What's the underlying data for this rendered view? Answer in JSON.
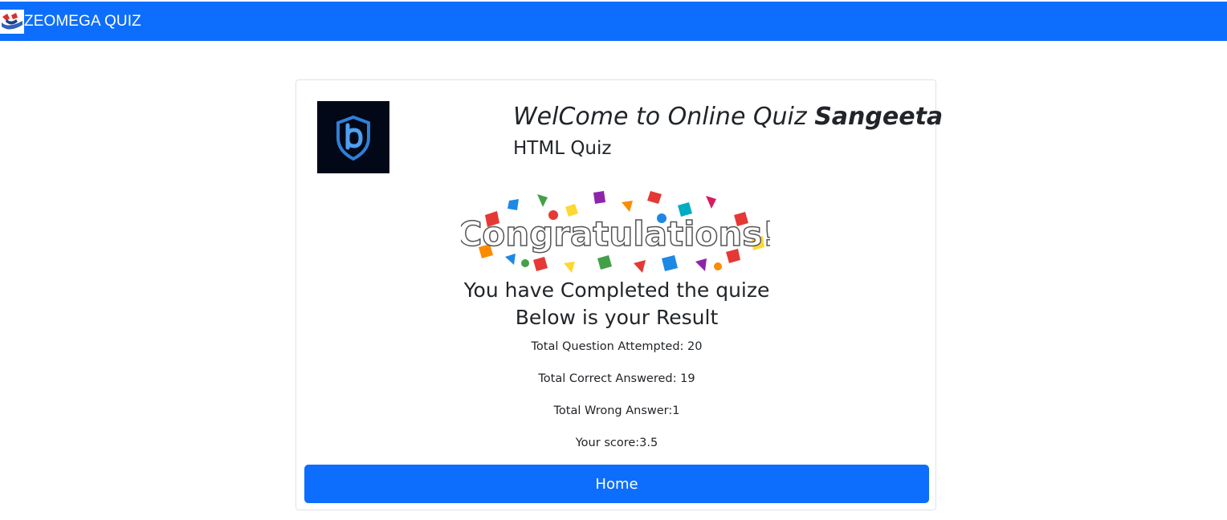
{
  "navbar": {
    "brand_text": "ZEOMEGA QUIZ",
    "brand_logo_icon": "zeomega-logo-icon",
    "color": "#0d6efd"
  },
  "card": {
    "course_logo_icon": "shield-b-logo-icon",
    "welcome_prefix": "WelCome to Online Quiz",
    "user_name": "Sangeeta",
    "quiz_name": "HTML Quiz",
    "congrats_image_text": "Congratulations!",
    "completed_line1": "You have Completed the quize",
    "completed_line2": "Below is your Result",
    "stats": {
      "attempted": "Total Question Attempted: 20",
      "correct": "Total Correct Answered: 19",
      "wrong": "Total Wrong Answer:1",
      "score": "Your score:3.5"
    },
    "home_button": "Home"
  }
}
